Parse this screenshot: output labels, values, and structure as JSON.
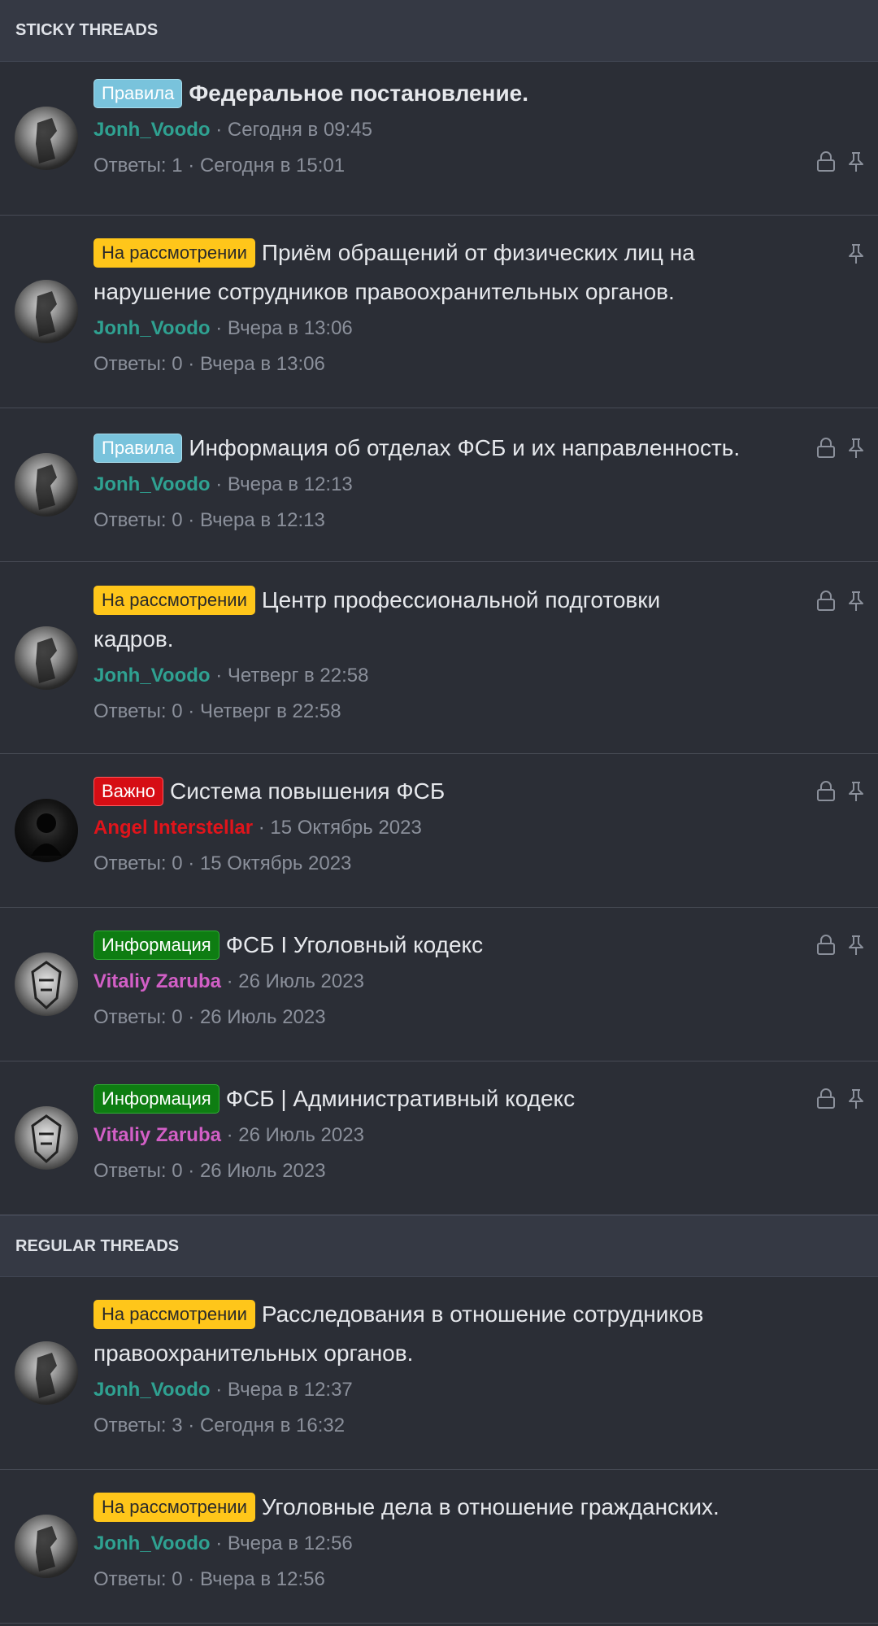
{
  "sections": {
    "sticky_title": "STICKY THREADS",
    "regular_title": "REGULAR THREADS"
  },
  "colors": {
    "background": "#2b2e36",
    "header": "#353944",
    "prefix_rules": "#79c3dc",
    "prefix_review": "#ffc61a",
    "prefix_important": "#d60d14",
    "prefix_info": "#0e7d12",
    "author_teal": "#2fa191",
    "author_red": "#e0141b",
    "author_pink": "#d25fc6"
  },
  "sticky": [
    {
      "prefix": "Правила",
      "title": "Федеральное постановление.",
      "author": "Jonh_Voodo",
      "sep": " · ",
      "date": "Сегодня в 09:45",
      "stats": "Ответы: 1 · Сегодня в 15:01",
      "icons": [
        "lock-icon",
        "pin-icon"
      ]
    },
    {
      "prefix": "На рассмотрении",
      "title": "Приём обращений от физических лиц на нарушение сотрудников правоохранительных органов.",
      "author": "Jonh_Voodo",
      "sep": " · ",
      "date": "Вчера в 13:06",
      "stats": "Ответы: 0 · Вчера в 13:06",
      "icons": [
        "pin-icon"
      ]
    },
    {
      "prefix": "Правила",
      "title": "Информация об отделах ФСБ и их направленность.",
      "author": "Jonh_Voodo",
      "sep": " · ",
      "date": "Вчера в 12:13",
      "stats": "Ответы: 0 · Вчера в 12:13",
      "icons": [
        "lock-icon",
        "pin-icon"
      ]
    },
    {
      "prefix": "На рассмотрении",
      "title": "Центр профессиональной подготовки кадров.",
      "author": "Jonh_Voodo",
      "sep": " · ",
      "date": "Четверг в 22:58",
      "stats": "Ответы: 0 · Четверг в 22:58",
      "icons": [
        "lock-icon",
        "pin-icon"
      ]
    },
    {
      "prefix": "Важно",
      "title": "Система повышения ФСБ",
      "author": "Angel Interstellar",
      "sep": " · ",
      "date": "15 Октябрь 2023",
      "stats": "Ответы: 0 · 15 Октябрь 2023",
      "icons": [
        "lock-icon",
        "pin-icon"
      ]
    },
    {
      "prefix": "Информация",
      "title": "ФСБ I Уголовный кодекс",
      "author": "Vitaliy Zaruba",
      "sep": " · ",
      "date": "26 Июль 2023",
      "stats": "Ответы: 0 · 26 Июль 2023",
      "icons": [
        "lock-icon",
        "pin-icon"
      ]
    },
    {
      "prefix": "Информация",
      "title": "ФСБ | Административный кодекс",
      "author": "Vitaliy Zaruba",
      "sep": " · ",
      "date": "26 Июль 2023",
      "stats": "Ответы: 0 · 26 Июль 2023",
      "icons": [
        "lock-icon",
        "pin-icon"
      ]
    }
  ],
  "regular": [
    {
      "prefix": "На рассмотрении",
      "title": "Расследования в отношение сотрудников правоохранительных органов.",
      "author": "Jonh_Voodo",
      "sep": " · ",
      "date": "Вчера в 12:37",
      "stats": "Ответы: 3 · Сегодня в 16:32"
    },
    {
      "prefix": "На рассмотрении",
      "title": "Уголовные дела в отношение гражданских.",
      "author": "Jonh_Voodo",
      "sep": " · ",
      "date": "Вчера в 12:56",
      "stats": "Ответы: 0 · Вчера в 12:56"
    }
  ]
}
